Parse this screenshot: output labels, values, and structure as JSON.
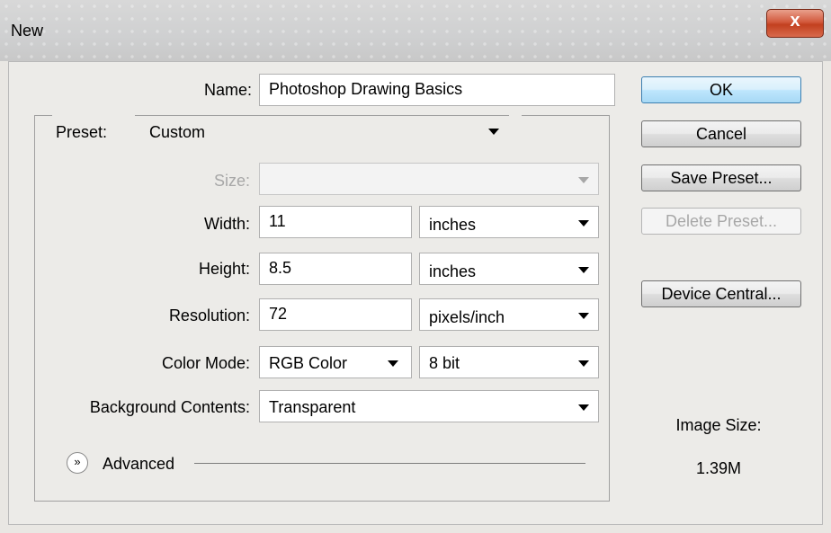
{
  "dialog": {
    "title": "New",
    "close_glyph": "x"
  },
  "form": {
    "name_label": "Name:",
    "name_value": "Photoshop Drawing Basics",
    "preset_label": "Preset:",
    "preset_value": "Custom",
    "size_label": "Size:",
    "size_value": "",
    "width_label": "Width:",
    "width_value": "11",
    "width_unit": "inches",
    "height_label": "Height:",
    "height_value": "8.5",
    "height_unit": "inches",
    "resolution_label": "Resolution:",
    "resolution_value": "72",
    "resolution_unit": "pixels/inch",
    "color_mode_label": "Color Mode:",
    "color_mode_value": "RGB Color",
    "bit_depth_value": "8 bit",
    "background_label": "Background Contents:",
    "background_value": "Transparent",
    "advanced_label": "Advanced"
  },
  "buttons": {
    "ok": "OK",
    "cancel": "Cancel",
    "save_preset": "Save Preset...",
    "delete_preset": "Delete Preset...",
    "device_central": "Device Central..."
  },
  "info": {
    "image_size_label": "Image Size:",
    "image_size_value": "1.39M"
  },
  "icons": {
    "close": "close-icon",
    "dropdown": "chevron-down-icon",
    "advanced_toggle": "double-chevron-down-icon"
  },
  "colors": {
    "close_button": "#c94a2b",
    "ok_button": "#bee6fd"
  }
}
